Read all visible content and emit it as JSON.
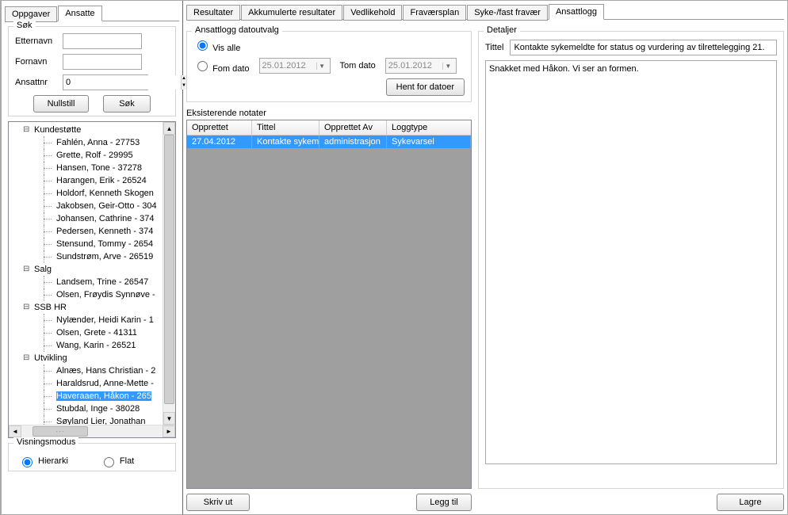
{
  "leftTabs": {
    "oppgaver": "Oppgaver",
    "ansatte": "Ansatte"
  },
  "search": {
    "title": "Søk",
    "etternavn_label": "Etternavn",
    "fornavn_label": "Fornavn",
    "ansattnr_label": "Ansattnr",
    "ansattnr_value": "0",
    "nullstill": "Nullstill",
    "sok": "Søk"
  },
  "tree": {
    "groups": {
      "kundestotte": "Kundestøtte",
      "salg": "Salg",
      "ssbhr": "SSB HR",
      "utvikling": "Utvikling"
    },
    "kundestotte_items": [
      "Fahlén, Anna - 27753",
      "Grette, Rolf - 29995",
      "Hansen, Tone - 37278",
      "Harangen, Erik - 26524",
      "Holdorf, Kenneth Skogen",
      "Jakobsen, Geir-Otto - 304",
      "Johansen, Cathrine - 374",
      "Pedersen, Kenneth - 374",
      "Stensund, Tommy - 2654",
      "Sundstrøm, Arve - 26519"
    ],
    "salg_items": [
      "Landsem, Trine - 26547",
      "Olsen, Frøydis Synnøve -"
    ],
    "ssbhr_items": [
      "Nylænder, Heidi Karin - 1",
      "Olsen, Grete - 41311",
      "Wang, Karin - 26521"
    ],
    "utvikling_items": [
      "Alnæs, Hans Christian - 2",
      "Haraldsrud, Anne-Mette -",
      "Haveraaen, Håkon - 265",
      "Stubdal, Inge - 38028",
      "Søyland Lier, Jonathan"
    ],
    "utvikling_selected_index": 2
  },
  "visningsmodus": {
    "title": "Visningsmodus",
    "hierarki": "Hierarki",
    "flat": "Flat"
  },
  "mainTabs": [
    "Resultater",
    "Akkumulerte resultater",
    "Vedlikehold",
    "Fraværsplan",
    "Syke-/fast fravær",
    "Ansattlogg"
  ],
  "dateRange": {
    "title": "Ansattlogg datoutvalg",
    "vis_alle": "Vis alle",
    "fom_dato": "Fom dato",
    "tom_dato": "Tom dato",
    "date1": "25.01.2012",
    "date2": "25.01.2012",
    "hent": "Hent for datoer"
  },
  "notater": {
    "title": "Eksisterende notater",
    "headers": {
      "opprettet": "Opprettet",
      "tittel": "Tittel",
      "opprettetav": "Opprettet Av",
      "loggtype": "Loggtype"
    },
    "row": {
      "opprettet": "27.04.2012",
      "tittel": "Kontakte sykem",
      "opprettetav": "administrasjon",
      "loggtype": "Sykevarsel"
    }
  },
  "detaljer": {
    "title": "Detaljer",
    "tittel_label": "Tittel",
    "tittel_value": "Kontakte sykemeldte for status og vurdering av tilrettelegging 21.",
    "body": "Snakket med Håkon. Vi ser an formen."
  },
  "buttons": {
    "skriv_ut": "Skriv ut",
    "legg_til": "Legg til",
    "lagre": "Lagre"
  }
}
